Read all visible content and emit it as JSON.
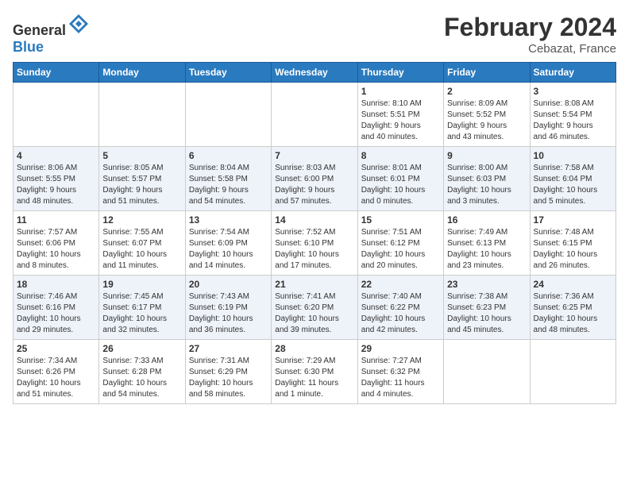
{
  "header": {
    "logo_general": "General",
    "logo_blue": "Blue",
    "month": "February 2024",
    "location": "Cebazat, France"
  },
  "weekdays": [
    "Sunday",
    "Monday",
    "Tuesday",
    "Wednesday",
    "Thursday",
    "Friday",
    "Saturday"
  ],
  "weeks": [
    [
      {
        "day": "",
        "info": ""
      },
      {
        "day": "",
        "info": ""
      },
      {
        "day": "",
        "info": ""
      },
      {
        "day": "",
        "info": ""
      },
      {
        "day": "1",
        "info": "Sunrise: 8:10 AM\nSunset: 5:51 PM\nDaylight: 9 hours\nand 40 minutes."
      },
      {
        "day": "2",
        "info": "Sunrise: 8:09 AM\nSunset: 5:52 PM\nDaylight: 9 hours\nand 43 minutes."
      },
      {
        "day": "3",
        "info": "Sunrise: 8:08 AM\nSunset: 5:54 PM\nDaylight: 9 hours\nand 46 minutes."
      }
    ],
    [
      {
        "day": "4",
        "info": "Sunrise: 8:06 AM\nSunset: 5:55 PM\nDaylight: 9 hours\nand 48 minutes."
      },
      {
        "day": "5",
        "info": "Sunrise: 8:05 AM\nSunset: 5:57 PM\nDaylight: 9 hours\nand 51 minutes."
      },
      {
        "day": "6",
        "info": "Sunrise: 8:04 AM\nSunset: 5:58 PM\nDaylight: 9 hours\nand 54 minutes."
      },
      {
        "day": "7",
        "info": "Sunrise: 8:03 AM\nSunset: 6:00 PM\nDaylight: 9 hours\nand 57 minutes."
      },
      {
        "day": "8",
        "info": "Sunrise: 8:01 AM\nSunset: 6:01 PM\nDaylight: 10 hours\nand 0 minutes."
      },
      {
        "day": "9",
        "info": "Sunrise: 8:00 AM\nSunset: 6:03 PM\nDaylight: 10 hours\nand 3 minutes."
      },
      {
        "day": "10",
        "info": "Sunrise: 7:58 AM\nSunset: 6:04 PM\nDaylight: 10 hours\nand 5 minutes."
      }
    ],
    [
      {
        "day": "11",
        "info": "Sunrise: 7:57 AM\nSunset: 6:06 PM\nDaylight: 10 hours\nand 8 minutes."
      },
      {
        "day": "12",
        "info": "Sunrise: 7:55 AM\nSunset: 6:07 PM\nDaylight: 10 hours\nand 11 minutes."
      },
      {
        "day": "13",
        "info": "Sunrise: 7:54 AM\nSunset: 6:09 PM\nDaylight: 10 hours\nand 14 minutes."
      },
      {
        "day": "14",
        "info": "Sunrise: 7:52 AM\nSunset: 6:10 PM\nDaylight: 10 hours\nand 17 minutes."
      },
      {
        "day": "15",
        "info": "Sunrise: 7:51 AM\nSunset: 6:12 PM\nDaylight: 10 hours\nand 20 minutes."
      },
      {
        "day": "16",
        "info": "Sunrise: 7:49 AM\nSunset: 6:13 PM\nDaylight: 10 hours\nand 23 minutes."
      },
      {
        "day": "17",
        "info": "Sunrise: 7:48 AM\nSunset: 6:15 PM\nDaylight: 10 hours\nand 26 minutes."
      }
    ],
    [
      {
        "day": "18",
        "info": "Sunrise: 7:46 AM\nSunset: 6:16 PM\nDaylight: 10 hours\nand 29 minutes."
      },
      {
        "day": "19",
        "info": "Sunrise: 7:45 AM\nSunset: 6:17 PM\nDaylight: 10 hours\nand 32 minutes."
      },
      {
        "day": "20",
        "info": "Sunrise: 7:43 AM\nSunset: 6:19 PM\nDaylight: 10 hours\nand 36 minutes."
      },
      {
        "day": "21",
        "info": "Sunrise: 7:41 AM\nSunset: 6:20 PM\nDaylight: 10 hours\nand 39 minutes."
      },
      {
        "day": "22",
        "info": "Sunrise: 7:40 AM\nSunset: 6:22 PM\nDaylight: 10 hours\nand 42 minutes."
      },
      {
        "day": "23",
        "info": "Sunrise: 7:38 AM\nSunset: 6:23 PM\nDaylight: 10 hours\nand 45 minutes."
      },
      {
        "day": "24",
        "info": "Sunrise: 7:36 AM\nSunset: 6:25 PM\nDaylight: 10 hours\nand 48 minutes."
      }
    ],
    [
      {
        "day": "25",
        "info": "Sunrise: 7:34 AM\nSunset: 6:26 PM\nDaylight: 10 hours\nand 51 minutes."
      },
      {
        "day": "26",
        "info": "Sunrise: 7:33 AM\nSunset: 6:28 PM\nDaylight: 10 hours\nand 54 minutes."
      },
      {
        "day": "27",
        "info": "Sunrise: 7:31 AM\nSunset: 6:29 PM\nDaylight: 10 hours\nand 58 minutes."
      },
      {
        "day": "28",
        "info": "Sunrise: 7:29 AM\nSunset: 6:30 PM\nDaylight: 11 hours\nand 1 minute."
      },
      {
        "day": "29",
        "info": "Sunrise: 7:27 AM\nSunset: 6:32 PM\nDaylight: 11 hours\nand 4 minutes."
      },
      {
        "day": "",
        "info": ""
      },
      {
        "day": "",
        "info": ""
      }
    ]
  ]
}
